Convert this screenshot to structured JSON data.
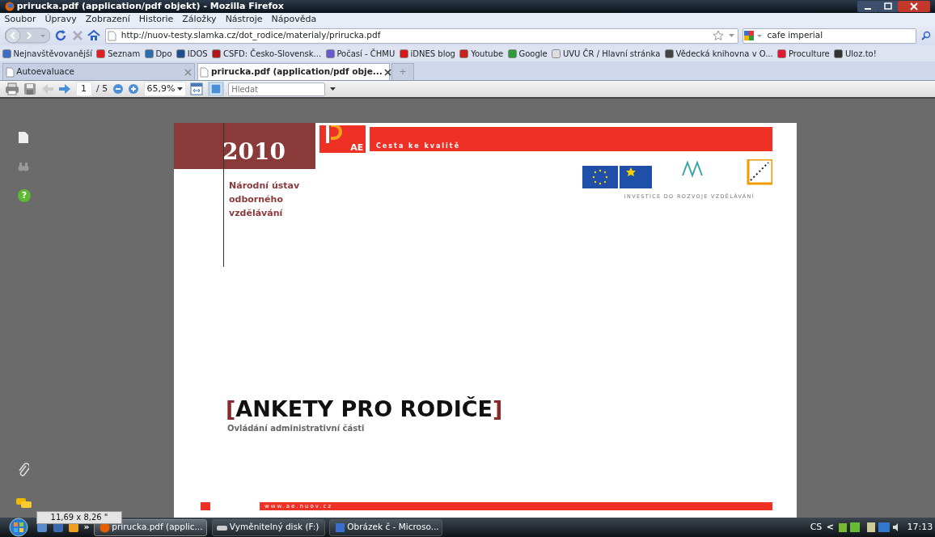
{
  "window": {
    "title": "prirucka.pdf (application/pdf objekt) - Mozilla Firefox"
  },
  "menu": [
    {
      "label": "Soubor"
    },
    {
      "label": "Úpravy"
    },
    {
      "label": "Zobrazení"
    },
    {
      "label": "Historie"
    },
    {
      "label": "Záložky"
    },
    {
      "label": "Nástroje"
    },
    {
      "label": "Nápověda"
    }
  ],
  "address_bar": {
    "value": "http://nuov-testy.slamka.cz/dot_rodice/materialy/prirucka.pdf"
  },
  "search": {
    "value": "cafe imperial"
  },
  "bookmarks": [
    {
      "label": "Nejnavštěvovanější",
      "color": "#3a6fc4"
    },
    {
      "label": "Seznam",
      "color": "#e02020"
    },
    {
      "label": "Dpo",
      "color": "#2a6fb0"
    },
    {
      "label": "IDOS",
      "color": "#1f4f8f"
    },
    {
      "label": "CSFD: Česko-Slovensk...",
      "color": "#b01818"
    },
    {
      "label": "Počasí - ČHMU",
      "color": "#6a5ad0"
    },
    {
      "label": "iDNES blog",
      "color": "#d81818"
    },
    {
      "label": "Youtube",
      "color": "#c8201a"
    },
    {
      "label": "Google",
      "color": "#2f9a3a"
    },
    {
      "label": "UVU ČR / Hlavní stránka",
      "color": "#dddddd"
    },
    {
      "label": "Vědecká knihovna v O...",
      "color": "#444444"
    },
    {
      "label": "Proculture",
      "color": "#e01830"
    },
    {
      "label": "Uloz.to!",
      "color": "#333333"
    }
  ],
  "tabs": [
    {
      "label": "Autoevaluace",
      "selected": false
    },
    {
      "label": "prirucka.pdf (application/pdf obje...",
      "selected": true
    }
  ],
  "pdf_toolbar": {
    "page": "1",
    "page_count": "/ 5",
    "zoom": "65,9%",
    "find_placeholder": "Hledat"
  },
  "document": {
    "year": "2010",
    "logo_text": "AE",
    "slogan": "Cesta ke kvalitě",
    "institute": [
      "Národní ústav",
      "odborného",
      "vzdělávání"
    ],
    "partner_caption": "INVESTICE DO ROZVOJE VZDĚLÁVÁNÍ",
    "title_open": "[",
    "title": "ANKETY PRO RODIČE",
    "title_close": "]",
    "subtitle": "Ovládání administrativní části",
    "url": "www.ae.nuov.cz"
  },
  "sidebar": {
    "help_glyph": "?"
  },
  "page_size": "11,69 x 8,26 \"",
  "taskbar": {
    "tasks": [
      {
        "label": "prirucka.pdf (applic...",
        "selected": true
      },
      {
        "label": "Vyměnitelný disk (F:)",
        "selected": false
      },
      {
        "label": "Obrázek č - Microso...",
        "selected": false
      }
    ],
    "overflow": "»",
    "language": "CS",
    "tray_arrow": "<",
    "clock": "17:13"
  }
}
